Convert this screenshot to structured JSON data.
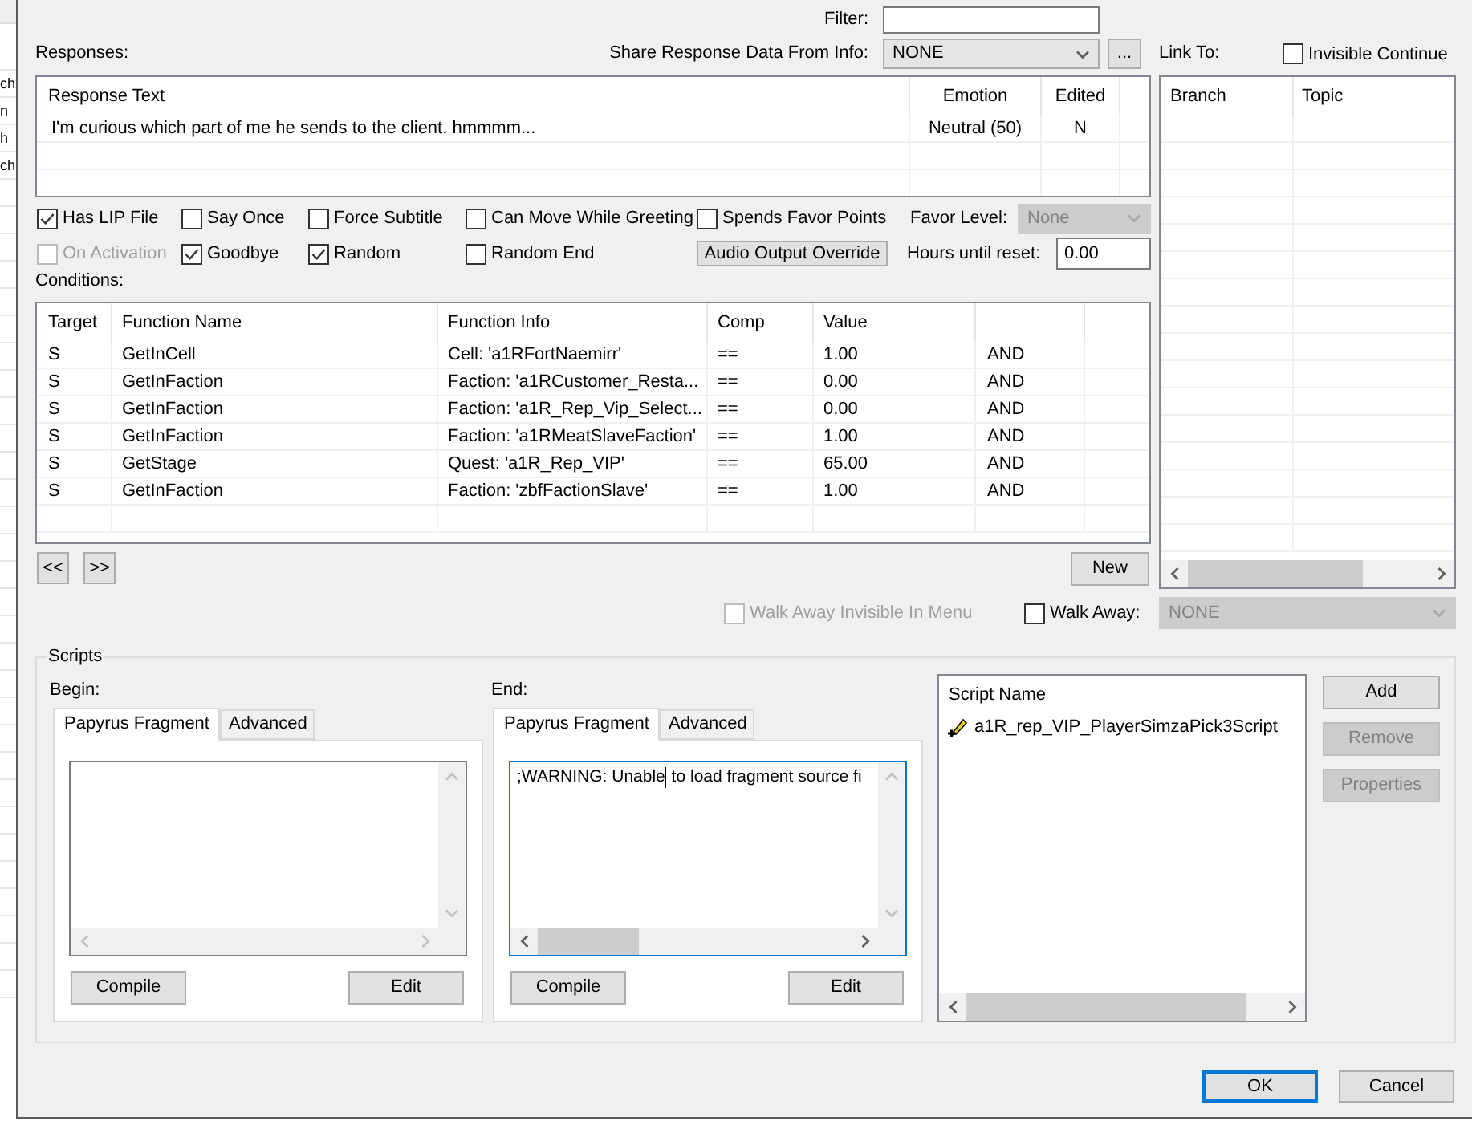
{
  "background_window": {
    "row_fragments": [
      "ch",
      "n",
      "h",
      "ch"
    ]
  },
  "filter": {
    "label": "Filter:"
  },
  "responses": {
    "label": "Responses:",
    "share_label": "Share Response Data From Info:",
    "share_value": "NONE",
    "more_button": "...",
    "columns": [
      "Response Text",
      "Emotion",
      "Edited"
    ],
    "rows": [
      {
        "response_text": "I'm curious which part of me he sends to the client. hmmmm...",
        "emotion": "Neutral (50)",
        "edited": "N"
      }
    ]
  },
  "link_to": {
    "label": "Link To:",
    "invisible_continue": {
      "label": "Invisible Continue",
      "checked": false
    },
    "columns": [
      "Branch",
      "Topic"
    ]
  },
  "flags": [
    {
      "label": "Has LIP File",
      "checked": true,
      "disabled": false
    },
    {
      "label": "Say Once",
      "checked": false,
      "disabled": false
    },
    {
      "label": "Force Subtitle",
      "checked": false,
      "disabled": false
    },
    {
      "label": "Can Move While Greeting",
      "checked": false,
      "disabled": false
    },
    {
      "label": "Spends Favor Points",
      "checked": false,
      "disabled": false
    },
    {
      "label": "On Activation",
      "checked": false,
      "disabled": true
    },
    {
      "label": "Goodbye",
      "checked": true,
      "disabled": false
    },
    {
      "label": "Random",
      "checked": true,
      "disabled": false
    },
    {
      "label": "Random End",
      "checked": false,
      "disabled": false
    }
  ],
  "audio_output_override_button": "Audio Output Override",
  "favor_level": {
    "label": "Favor Level:",
    "value": "None",
    "disabled": true
  },
  "hours_until_reset": {
    "label": "Hours until reset:",
    "value": "0.00"
  },
  "conditions": {
    "label": "Conditions:",
    "columns": [
      "Target",
      "Function Name",
      "Function Info",
      "Comp",
      "Value"
    ],
    "rows": [
      {
        "target": "S",
        "function_name": "GetInCell",
        "function_info": "Cell: 'a1RFortNaemirr'",
        "comp": "==",
        "value": "1.00",
        "column_6": "AND"
      },
      {
        "target": "S",
        "function_name": "GetInFaction",
        "function_info": "Faction: 'a1RCustomer_Resta...",
        "comp": "==",
        "value": "0.00",
        "column_6": "AND"
      },
      {
        "target": "S",
        "function_name": "GetInFaction",
        "function_info": "Faction: 'a1R_Rep_Vip_Select...",
        "comp": "==",
        "value": "0.00",
        "column_6": "AND"
      },
      {
        "target": "S",
        "function_name": "GetInFaction",
        "function_info": "Faction: 'a1RMeatSlaveFaction'",
        "comp": "==",
        "value": "1.00",
        "column_6": "AND"
      },
      {
        "target": "S",
        "function_name": "GetStage",
        "function_info": "Quest: 'a1R_Rep_VIP'",
        "comp": "==",
        "value": "65.00",
        "column_6": "AND"
      },
      {
        "target": "S",
        "function_name": "GetInFaction",
        "function_info": "Faction: 'zbfFactionSlave'",
        "comp": "==",
        "value": "1.00",
        "column_6": "AND"
      }
    ]
  },
  "condition_nav_buttons": [
    "<<",
    ">>"
  ],
  "new_button": "New",
  "walk_away_invisible_in_menu": {
    "label": "Walk Away Invisible In Menu",
    "checked": false,
    "disabled": true
  },
  "walk_away": {
    "label": "Walk Away:",
    "checked": false,
    "value": "NONE",
    "disabled": true
  },
  "scripts": {
    "title": "Scripts",
    "panes": [
      {
        "label": "Begin:",
        "tabs": [
          {
            "label": "Papyrus Fragment",
            "selected": true
          },
          {
            "label": "Advanced",
            "selected": false
          }
        ],
        "focused": false,
        "compile_button": "Compile",
        "edit_button": "Edit"
      },
      {
        "label": "End:",
        "tabs": [
          {
            "label": "Papyrus Fragment",
            "selected": true
          },
          {
            "label": "Advanced",
            "selected": false
          }
        ],
        "focused": true,
        "text_before_cursor": ";WARNING: Unable",
        "text_after_cursor": " to load fragment source fi",
        "compile_button": "Compile",
        "edit_button": "Edit"
      }
    ],
    "script_list": {
      "column": "Script Name",
      "items": [
        {
          "name": "a1R_rep_VIP_PlayerSimzaPick3Script"
        }
      ]
    },
    "buttons": [
      {
        "label": "Add",
        "disabled": false
      },
      {
        "label": "Remove",
        "disabled": true
      },
      {
        "label": "Properties",
        "disabled": true
      }
    ]
  },
  "dialog_buttons": [
    {
      "label": "OK",
      "default": true
    },
    {
      "label": "Cancel",
      "default": false
    }
  ]
}
